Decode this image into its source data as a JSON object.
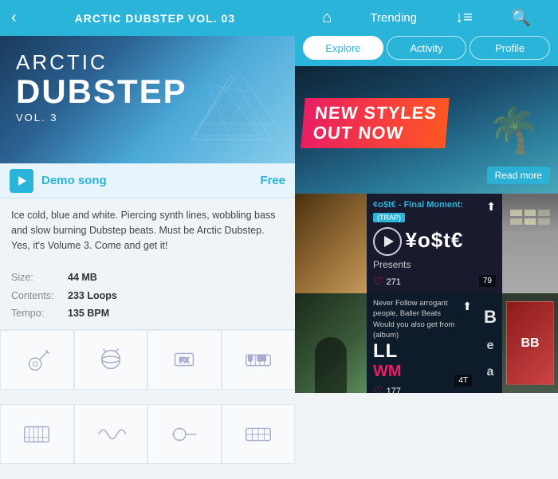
{
  "left": {
    "header": {
      "title": "ARCTIC DUBSTEP VOL. 03",
      "back_label": "‹"
    },
    "album": {
      "arctic": "ARCTIC",
      "dubstep": "DUBSTEP",
      "vol": "VOL. 3"
    },
    "demo_bar": {
      "demo_label": "Demo song",
      "free_label": "Free"
    },
    "description": "Ice cold, blue and white. Piercing synth lines, wobbling bass and slow burning Dubstep beats. Must be Arctic Dubstep. Yes, it's Volume 3. Come and get it!",
    "meta": {
      "size_label": "Size:",
      "size_value": "44 MB",
      "contents_label": "Contents:",
      "contents_value": "233 Loops",
      "tempo_label": "Tempo:",
      "tempo_value": "135 BPM"
    }
  },
  "right": {
    "header": {
      "home_icon": "⌂",
      "trending_label": "Trending",
      "filter_icon": "↓≡",
      "search_icon": "🔍"
    },
    "tabs": [
      {
        "label": "Explore",
        "active": true
      },
      {
        "label": "Activity",
        "active": false
      },
      {
        "label": "Profile",
        "active": false
      }
    ],
    "banner": {
      "headline_line1": "NEW STYLES",
      "headline_line2": "OUT NOW",
      "read_more": "Read more"
    },
    "track1": {
      "artist": "¢o$t€ - Final Moment:",
      "genre": "(TRAP)",
      "big_name": "¥o$t€",
      "presents": "Presents",
      "likes": "271",
      "badge": "79"
    },
    "track2": {
      "info_line1": "Never Follow arrogant",
      "info_line2": "people, Baller Beats",
      "info_line3": "Would you also get from",
      "info_line4": "(album)",
      "big1": "LL",
      "big2": "WM",
      "letters": [
        "B",
        "e",
        "a"
      ],
      "likes": "177",
      "badge": "4T"
    }
  }
}
